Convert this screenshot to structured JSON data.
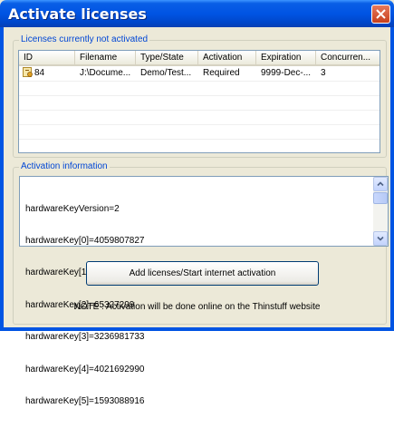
{
  "window": {
    "title": "Activate licenses"
  },
  "licenses_group": {
    "label": "Licenses currently not activated"
  },
  "table": {
    "columns": [
      "ID",
      "Filename",
      "Type/State",
      "Activation",
      "Expiration",
      "Concurren..."
    ],
    "rows": [
      {
        "id": "84",
        "filename": "J:\\Docume...",
        "type_state": "Demo/Test...",
        "activation": "Required",
        "expiration": "9999-Dec-...",
        "concurrent": "3"
      }
    ]
  },
  "activation_group": {
    "label": "Activation information",
    "lines": [
      "hardwareKeyVersion=2",
      "hardwareKey[0]=4059807827",
      "hardwareKey[1]=3482",
      "hardwareKey[2]=65327299",
      "hardwareKey[3]=3236981733",
      "hardwareKey[4]=4021692990",
      "hardwareKey[5]=1593088916"
    ]
  },
  "buttons": {
    "add_licenses": "Add licenses/Start internet activation"
  },
  "note": "NOTE : Activation will be done online on the Thinstuff website"
}
